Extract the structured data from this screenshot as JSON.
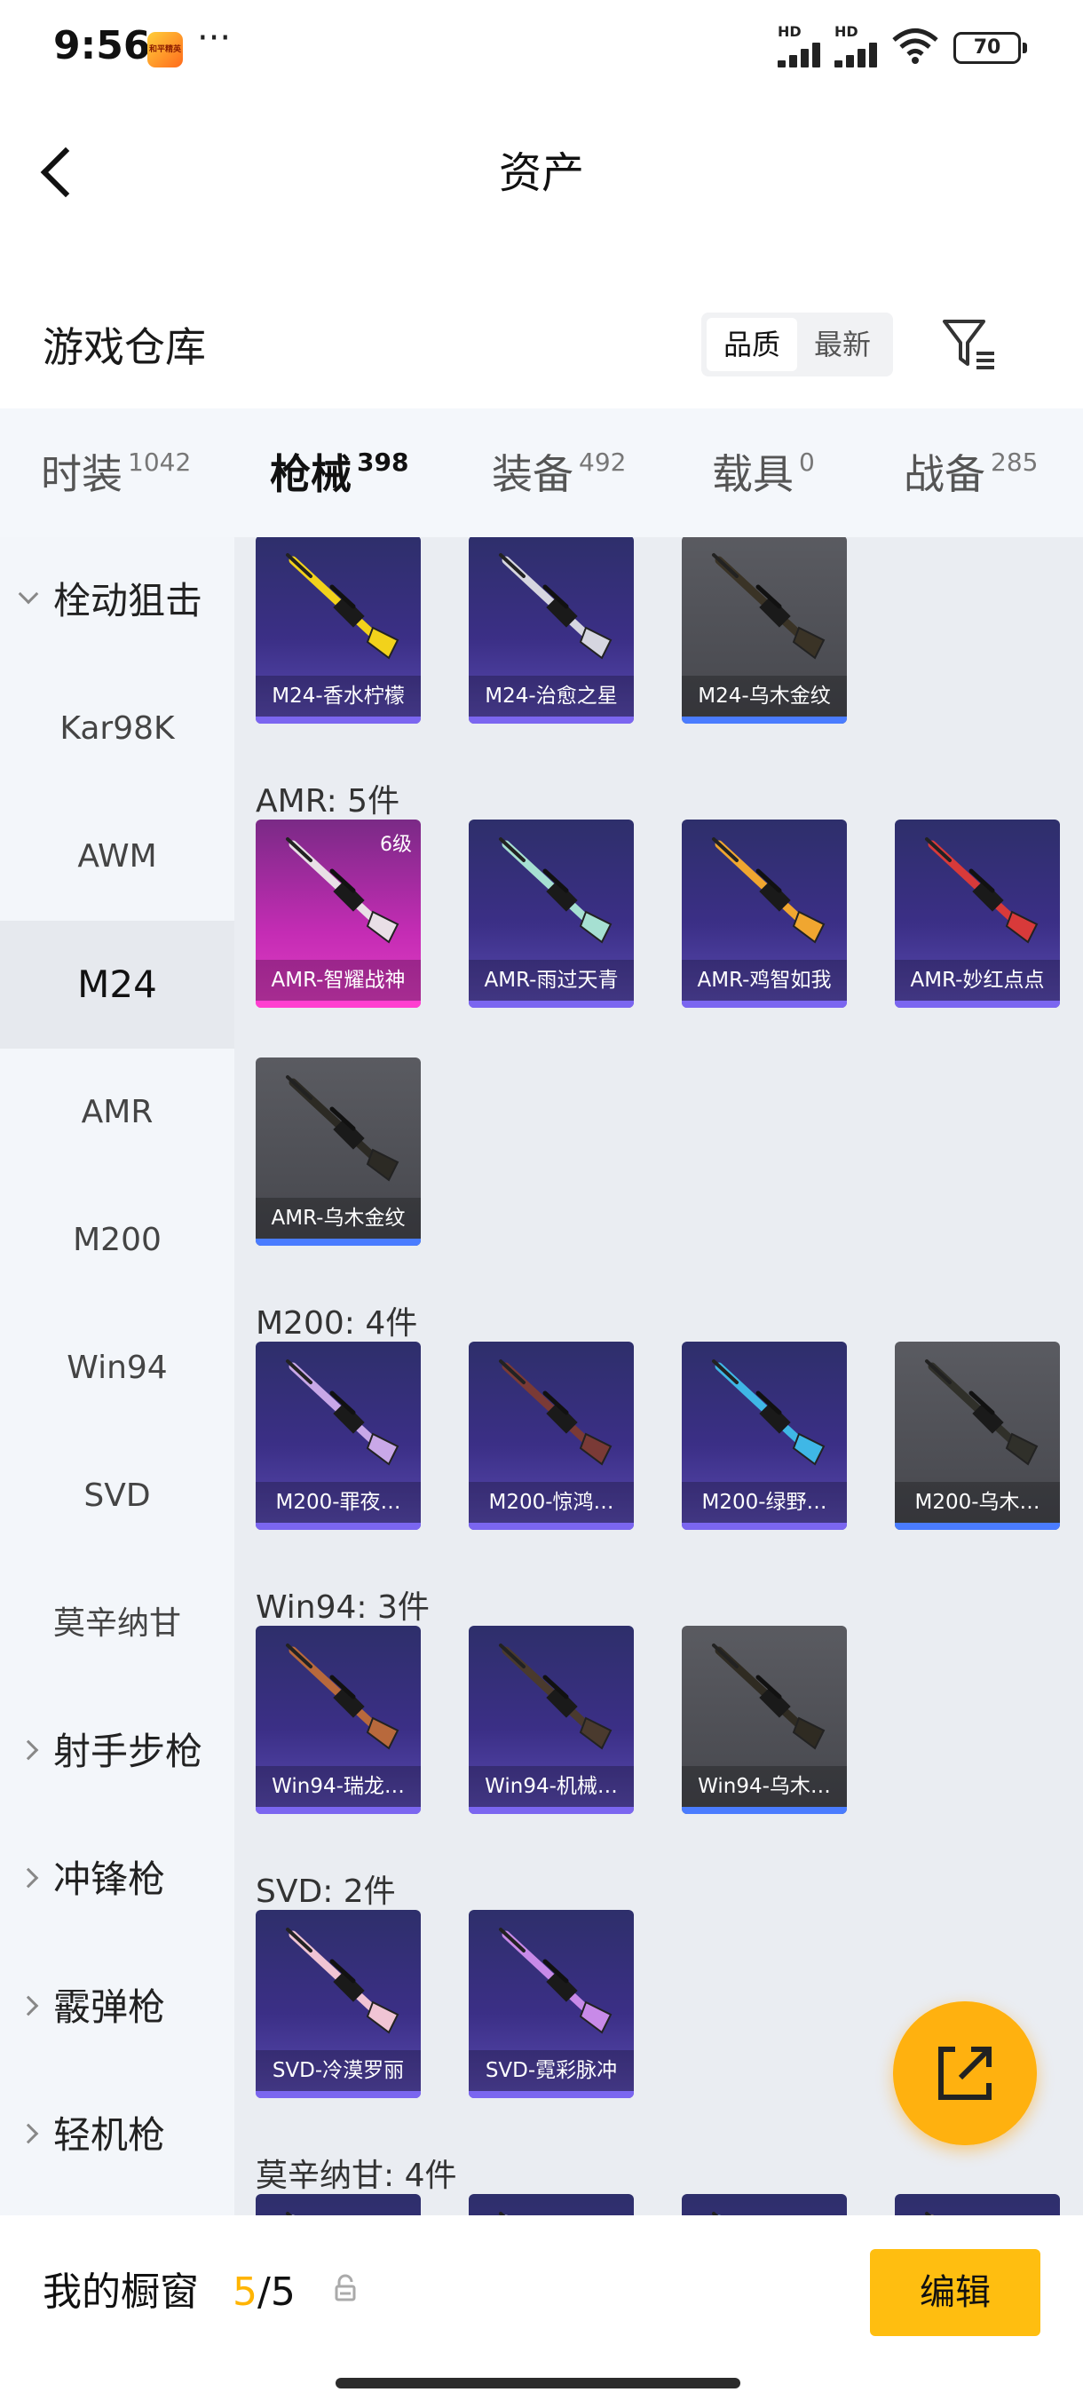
{
  "status": {
    "time": "9:56",
    "app_icon_text": "和平精英",
    "battery": "70",
    "hd": "HD"
  },
  "header": {
    "title": "资产"
  },
  "warehouse": {
    "title": "游戏仓库",
    "sort_options": [
      "品质",
      "最新"
    ],
    "sort_selected": "品质"
  },
  "tabs": [
    {
      "label": "时装",
      "count": "1042"
    },
    {
      "label": "枪械",
      "count": "398"
    },
    {
      "label": "装备",
      "count": "492"
    },
    {
      "label": "载具",
      "count": "0"
    },
    {
      "label": "战备",
      "count": "285"
    }
  ],
  "sidebar": {
    "group_open": "栓动狙击",
    "items": [
      "Kar98K",
      "AWM",
      "M24",
      "AMR",
      "M200",
      "Win94",
      "SVD",
      "莫辛纳甘"
    ],
    "selected": "M24",
    "groups": [
      "射手步枪",
      "冲锋枪",
      "霰弹枪",
      "轻机枪"
    ]
  },
  "sections": [
    {
      "title": "",
      "items": [
        {
          "name": "M24-香水柠檬",
          "style": "purple",
          "gun": "#f2d21b"
        },
        {
          "name": "M24-治愈之星",
          "style": "purple",
          "gun": "#d6d6e0"
        },
        {
          "name": "M24-乌木金纹",
          "style": "gray",
          "gun": "#3a3326"
        }
      ]
    },
    {
      "title": "AMR: 5件",
      "items": [
        {
          "name": "AMR-智耀战神",
          "style": "pink",
          "level": "6级",
          "gun": "#e9dfe6"
        },
        {
          "name": "AMR-雨过天青",
          "style": "purple",
          "gun": "#a6e0d2"
        },
        {
          "name": "AMR-鸡智如我",
          "style": "purple",
          "gun": "#f0a630"
        },
        {
          "name": "AMR-妙红点点",
          "style": "purple",
          "gun": "#d83a3a"
        },
        {
          "name": "AMR-乌木金纹",
          "style": "gray",
          "gun": "#2c2a24"
        }
      ]
    },
    {
      "title": "M200: 4件",
      "items": [
        {
          "name": "M200-罪夜…",
          "style": "purple",
          "gun": "#c9a8e8"
        },
        {
          "name": "M200-惊鸿…",
          "style": "purple",
          "gun": "#7a3a36"
        },
        {
          "name": "M200-绿野…",
          "style": "purple",
          "gun": "#3fb7e6"
        },
        {
          "name": "M200-乌木…",
          "style": "gray",
          "gun": "#30302a"
        }
      ]
    },
    {
      "title": "Win94: 3件",
      "items": [
        {
          "name": "Win94-瑞龙…",
          "style": "purple",
          "gun": "#b8693c"
        },
        {
          "name": "Win94-机械…",
          "style": "purple",
          "gun": "#4a3a2e"
        },
        {
          "name": "Win94-乌木…",
          "style": "gray",
          "gun": "#2f2b22"
        }
      ]
    },
    {
      "title": "SVD: 2件",
      "items": [
        {
          "name": "SVD-冷漠罗丽",
          "style": "purple",
          "gun": "#f0c4d4"
        },
        {
          "name": "SVD-霓彩脉冲",
          "style": "purple",
          "gun": "#c88ae8"
        }
      ]
    },
    {
      "title": "莫辛纳甘: 4件",
      "items": [
        {
          "name": "",
          "style": "purple",
          "gun": "#e0e0e0"
        },
        {
          "name": "",
          "style": "purple",
          "gun": "#e0e0e0"
        },
        {
          "name": "",
          "style": "purple",
          "gun": "#8fd4e8"
        },
        {
          "name": "",
          "style": "purple",
          "gun": "#d4b04a"
        }
      ]
    }
  ],
  "bottom": {
    "showcase_label": "我的橱窗",
    "count_current": "5",
    "count_rest": "/5",
    "edit_label": "编辑"
  },
  "colors": {
    "accent": "#ffb400",
    "card_purple": "#3b2f86",
    "card_gray": "#4f5056",
    "card_pink": "#c42cb4"
  },
  "icons": [
    "back-arrow-icon",
    "filter-icon",
    "share-out-icon",
    "lock-icon",
    "wifi-icon",
    "signal-icon",
    "battery-icon"
  ]
}
